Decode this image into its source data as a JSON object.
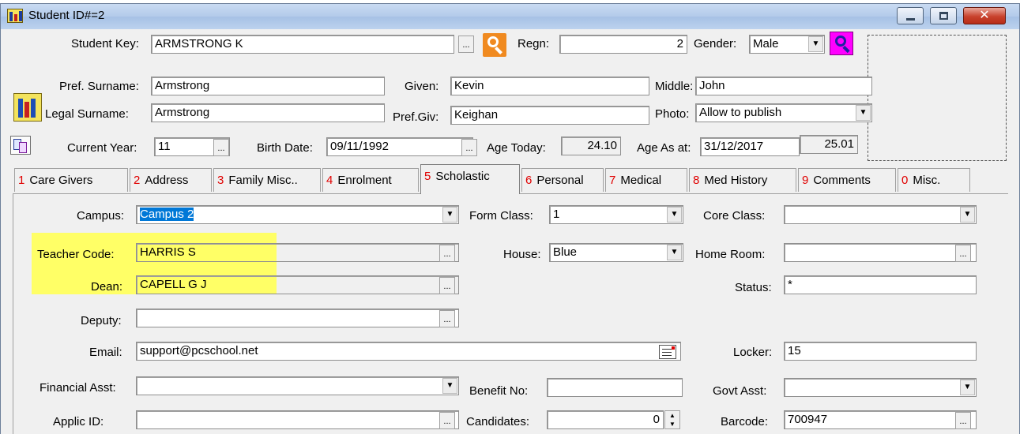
{
  "window": {
    "title": "Student ID#=2"
  },
  "header": {
    "student_key_label": "Student Key:",
    "student_key": "ARMSTRONG K",
    "regn_label": "Regn:",
    "regn": "2",
    "gender_label": "Gender:",
    "gender": "Male",
    "pref_surname_label": "Pref. Surname:",
    "pref_surname": "Armstrong",
    "given_label": "Given:",
    "given": "Kevin",
    "middle_label": "Middle:",
    "middle": "John",
    "legal_surname_label": "Legal Surname:",
    "legal_surname": "Armstrong",
    "pref_giv_label": "Pref.Giv:",
    "pref_giv": "Keighan",
    "photo_label": "Photo:",
    "photo": "Allow to publish",
    "current_year_label": "Current Year:",
    "current_year": "11",
    "birth_date_label": "Birth Date:",
    "birth_date": "09/11/1992",
    "age_today_label": "Age Today:",
    "age_today": "24.10",
    "age_as_at_label": "Age As at:",
    "age_as_at_date": "31/12/2017",
    "age_as_at": "25.01"
  },
  "tabs": [
    {
      "num": "1",
      "label": "Care Givers"
    },
    {
      "num": "2",
      "label": "Address"
    },
    {
      "num": "3",
      "label": "Family Misc.."
    },
    {
      "num": "4",
      "label": "Enrolment"
    },
    {
      "num": "5",
      "label": "Scholastic"
    },
    {
      "num": "6",
      "label": "Personal"
    },
    {
      "num": "7",
      "label": "Medical"
    },
    {
      "num": "8",
      "label": "Med History"
    },
    {
      "num": "9",
      "label": "Comments"
    },
    {
      "num": "0",
      "label": "Misc."
    }
  ],
  "scholastic": {
    "campus_label": "Campus:",
    "campus": "Campus 2",
    "form_class_label": "Form Class:",
    "form_class": "1",
    "core_class_label": "Core Class:",
    "core_class": "",
    "teacher_code_label": "Teacher Code:",
    "teacher_code": "HARRIS S",
    "house_label": "House:",
    "house": "Blue",
    "home_room_label": "Home Room:",
    "home_room": "",
    "dean_label": "Dean:",
    "dean": "CAPELL G J",
    "status_label": "Status:",
    "status": "*",
    "deputy_label": "Deputy:",
    "deputy": "",
    "email_label": "Email:",
    "email": "support@pcschool.net",
    "locker_label": "Locker:",
    "locker": "15",
    "financial_asst_label": "Financial Asst:",
    "financial_asst": "",
    "benefit_no_label": "Benefit No:",
    "benefit_no": "",
    "govt_asst_label": "Govt Asst:",
    "govt_asst": "",
    "applic_id_label": "Applic ID:",
    "applic_id": "",
    "candidates_label": "Candidates:",
    "candidates": "0",
    "barcode_label": "Barcode:",
    "barcode": "700947"
  },
  "colors": {
    "highlight": "#ffff66",
    "selection": "#0078d7",
    "tab_number": "#e00000"
  },
  "icons": [
    "app-icon",
    "family-icon",
    "search-orange-icon",
    "search-magenta-icon",
    "copy-icon",
    "email-icon"
  ]
}
